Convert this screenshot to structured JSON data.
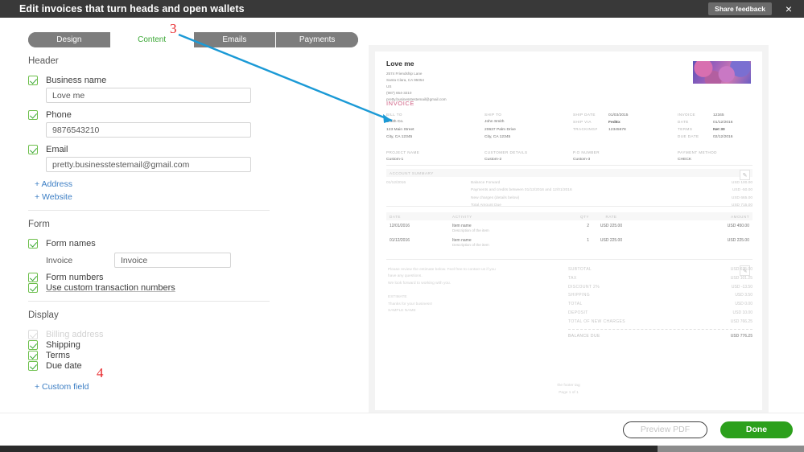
{
  "window": {
    "title": "Edit invoices that turn heads and open wallets",
    "share_feedback": "Share feedback",
    "close_icon": "×"
  },
  "tabs": [
    {
      "label": "Design",
      "active": false
    },
    {
      "label": "Content",
      "active": true
    },
    {
      "label": "Emails",
      "active": false
    },
    {
      "label": "Payments",
      "active": false
    }
  ],
  "annotations": [
    {
      "number": "3"
    },
    {
      "number": "4"
    }
  ],
  "form": {
    "header_section": {
      "title": "Header",
      "business_name": {
        "label": "Business name",
        "value": "Love me",
        "checked": true
      },
      "phone": {
        "label": "Phone",
        "value": "9876543210",
        "checked": true
      },
      "email": {
        "label": "Email",
        "value": "pretty.businesstestemail@gmail.com",
        "checked": true
      },
      "add_address": "+ Address",
      "add_website": "+ Website"
    },
    "form_section": {
      "title": "Form",
      "form_names": {
        "label": "Form names",
        "checked": true
      },
      "invoice_label": "Invoice",
      "invoice_value": "Invoice",
      "form_numbers": {
        "label": "Form numbers",
        "checked": true
      },
      "custom_transaction_numbers": {
        "label": "Use custom transaction numbers",
        "checked": true
      }
    },
    "display_section": {
      "title": "Display",
      "items": [
        {
          "label": "Billing address",
          "checked": true,
          "disabled": true
        },
        {
          "label": "Shipping",
          "checked": true,
          "disabled": false
        },
        {
          "label": "Terms",
          "checked": true,
          "disabled": false
        },
        {
          "label": "Due date",
          "checked": true,
          "disabled": false
        }
      ],
      "add_custom_field": "+ Custom field"
    }
  },
  "preview": {
    "company": {
      "name": "Love me",
      "address": [
        "2574  Friendship Lane",
        "Santa Clara, CA 95054",
        "US",
        "(987) 654-3210",
        "pretty.businesstestemail@gmail.com"
      ]
    },
    "doc_title": "INVOICE",
    "bill_to": {
      "label": "BILL TO",
      "lines": [
        "Smith Co.",
        "123 Main Street",
        "City, CA 12345"
      ]
    },
    "ship_to": {
      "label": "SHIP TO",
      "lines": [
        "John Smith",
        "20637 Palm Drive",
        "City, CA 12345"
      ]
    },
    "ship_meta": [
      {
        "key": "SHIP DATE",
        "value": "01/03/2015",
        "bold": false
      },
      {
        "key": "SHIP VIA",
        "value": "FedEx",
        "bold": true
      },
      {
        "key": "TRACKING#",
        "value": "12345678",
        "bold": false
      }
    ],
    "invoice_meta": [
      {
        "key": "INVOICE",
        "value": "12345",
        "bold": false
      },
      {
        "key": "DATE",
        "value": "01/12/2016",
        "bold": false
      },
      {
        "key": "TERMS",
        "value": "Net 30",
        "bold": true
      },
      {
        "key": "DUE DATE",
        "value": "02/12/2016",
        "bold": false
      }
    ],
    "custom_fields": [
      {
        "label": "PROJECT NAME",
        "value": "Custom-1"
      },
      {
        "label": "CUSTOMER DETAILS",
        "value": "Custom-2"
      },
      {
        "label": "P.O NUMBER",
        "value": "Custom-3"
      },
      {
        "label": "PAYMENT METHOD",
        "value": "CHECK"
      }
    ],
    "account_summary": {
      "header": "ACCOUNT SUMMARY",
      "date": "01/12/2016",
      "rows": [
        {
          "text": "Balance Forward",
          "amount": "USD 100.00"
        },
        {
          "text": "Payments and credits between 01/12/2016 and 12/01/2016",
          "amount": "USD -50.00"
        },
        {
          "text": "New charges (details below)",
          "amount": "USD 665.00"
        },
        {
          "text": "Total Amount Due",
          "amount": "USD 715.00"
        }
      ]
    },
    "items_table": {
      "columns": [
        "DATE",
        "ACTIVITY",
        "QTY",
        "RATE",
        "AMOUNT"
      ],
      "rows": [
        {
          "date": "12/01/2016",
          "name": "Item name",
          "desc": "Description of the item",
          "qty": "2",
          "rate": "USD 225.00",
          "amount": "USD 450.00"
        },
        {
          "date": "01/12/2016",
          "name": "Item name",
          "desc": "Description of the item",
          "qty": "1",
          "rate": "USD 225.00",
          "amount": "USD 225.00"
        }
      ]
    },
    "message": {
      "line1": "Please review the estimate below.  Feel free to contact us if you",
      "line2": "have any questions.",
      "line3": "We look forward to working with you.",
      "title": "ESTIMATE",
      "thanks": "Thanks for your business!",
      "sample": "SAMPLE NAME"
    },
    "totals": [
      {
        "key": "SUBTOTAL",
        "value": "USD 675.00"
      },
      {
        "key": "TAX",
        "value": "USD 101.25"
      },
      {
        "key": "DISCOUNT 2%",
        "value": "USD -13.50"
      },
      {
        "key": "SHIPPING",
        "value": "USD 3.50"
      },
      {
        "key": "TOTAL",
        "value": "USD 0.00"
      },
      {
        "key": "DEPOSIT",
        "value": "USD 10.00"
      },
      {
        "key": "TOTAL OF NEW CHARGES",
        "value": "USD 766.25"
      }
    ],
    "balance_due": {
      "key": "BALANCE DUE",
      "value": "USD 776.25"
    },
    "footer": {
      "line1": "the footer tag",
      "line2": "Page 1 of 1"
    },
    "edit_icon": "✎"
  },
  "footer_bar": {
    "preview_pdf": "Preview PDF",
    "done": "Done"
  },
  "colors": {
    "accent_green": "#2ca01c",
    "tab_active_text": "#3aa734",
    "link_blue": "#3c7ec4",
    "annotation_red": "#e8262a",
    "arrow_blue": "#1b9ad6",
    "titlebar": "#393939"
  }
}
